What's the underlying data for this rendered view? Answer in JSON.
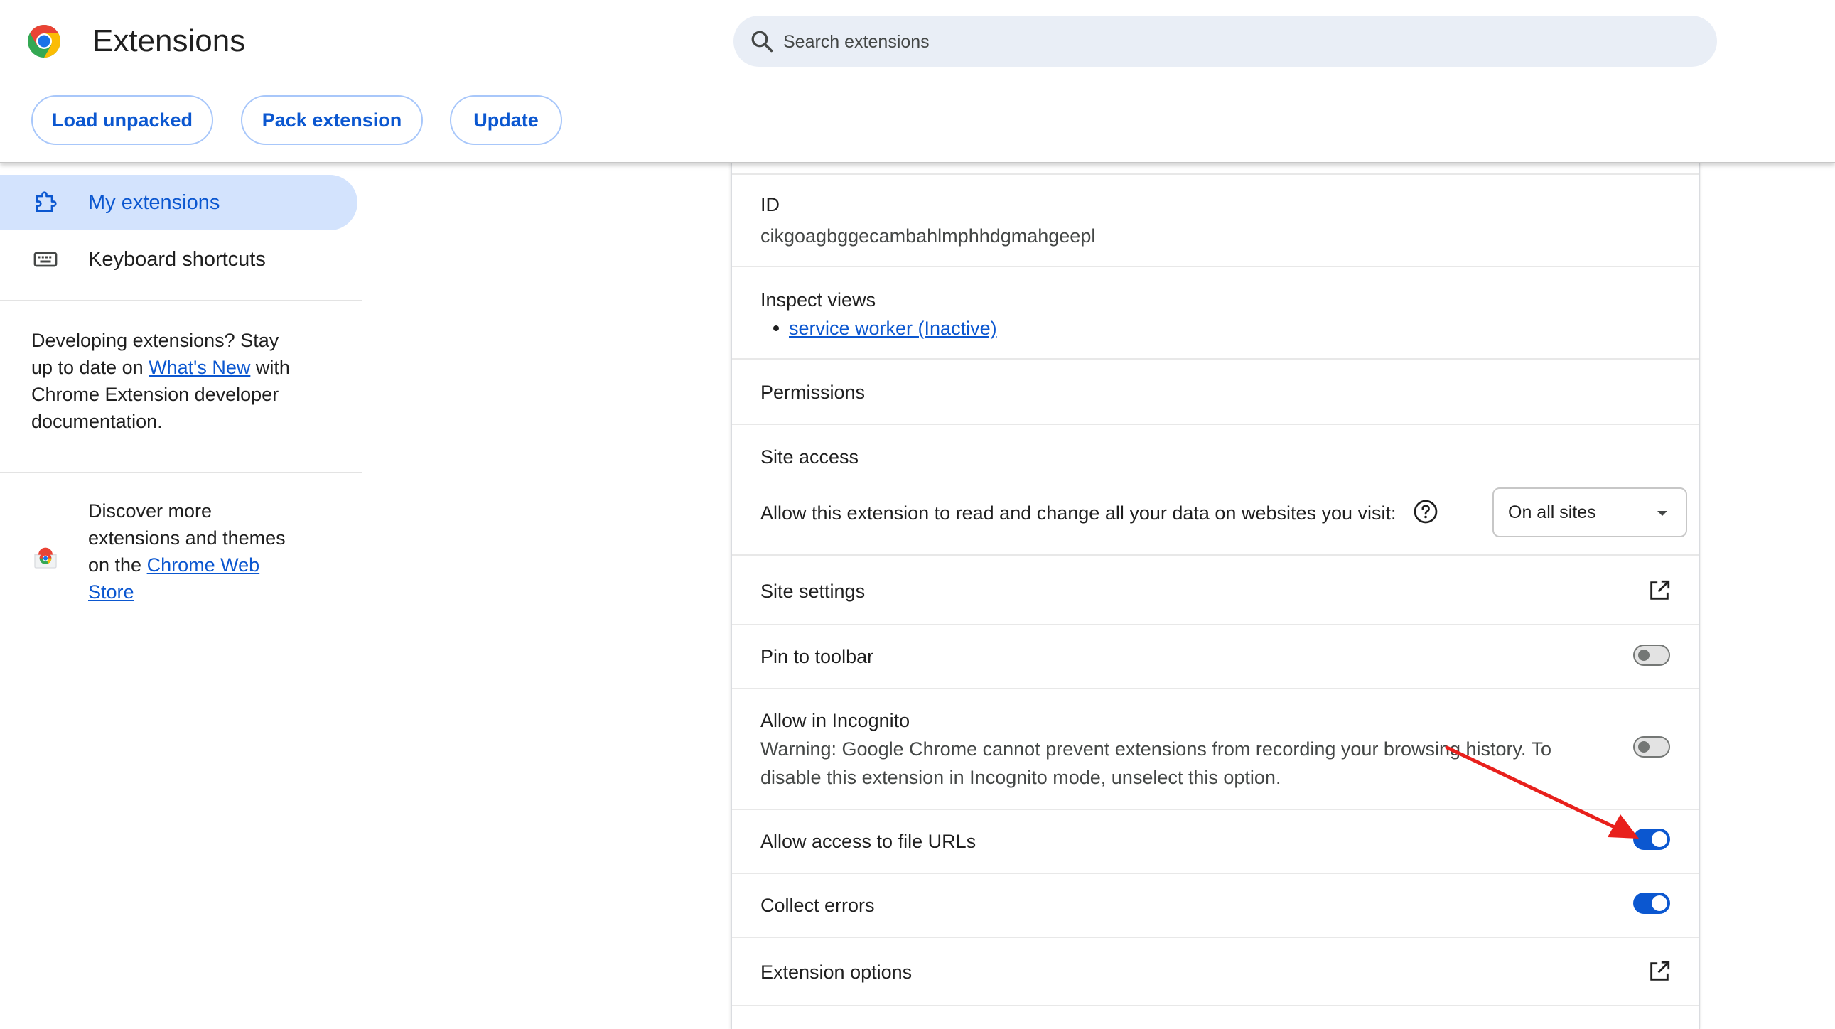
{
  "header": {
    "title": "Extensions",
    "search_placeholder": "Search extensions",
    "buttons": {
      "load_unpacked": "Load unpacked",
      "pack_extension": "Pack extension",
      "update": "Update"
    }
  },
  "sidebar": {
    "items": [
      {
        "label": "My extensions",
        "active": true,
        "icon": "puzzle-icon"
      },
      {
        "label": "Keyboard shortcuts",
        "active": false,
        "icon": "keyboard-icon"
      }
    ],
    "dev_note": {
      "line1": "Developing extensions? Stay",
      "line2_pre": "up to date on",
      "line2_link": "What's New",
      "line2_post": "with",
      "line3": "Chrome Extension developer",
      "line4": "documentation."
    },
    "store_note": {
      "line1": "Discover more",
      "line2": "extensions and themes",
      "line3_pre": "on the",
      "line3_link": "Chrome Web",
      "line4_link": "Store"
    }
  },
  "details": {
    "id_label": "ID",
    "id_value": "cikgoagbggecambahlmphhdgmahgeepl",
    "inspect_label": "Inspect views",
    "inspect_link": "service worker (Inactive)",
    "permissions_label": "Permissions",
    "site_access_label": "Site access",
    "site_access_question": "Allow this extension to read and change all your data on websites you visit:",
    "site_access_value": "On all sites",
    "site_settings_label": "Site settings",
    "pin_label": "Pin to toolbar",
    "pin_on": false,
    "incognito_label": "Allow in Incognito",
    "incognito_warning_1": "Warning: Google Chrome cannot prevent extensions from recording your browsing history. To",
    "incognito_warning_2": "disable this extension in Incognito mode, unselect this option.",
    "incognito_on": false,
    "file_urls_label": "Allow access to file URLs",
    "file_urls_on": true,
    "collect_errors_label": "Collect errors",
    "collect_errors_on": true,
    "options_label": "Extension options"
  },
  "colors": {
    "accent": "#0b57d0",
    "toggle_off": "#747775",
    "annotation_arrow": "#e8201c"
  }
}
